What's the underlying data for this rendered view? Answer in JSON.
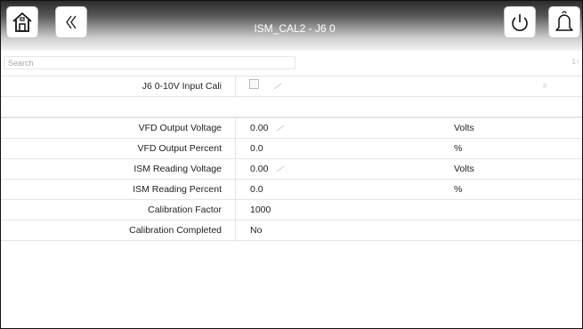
{
  "header": {
    "title": "ISM_CAL2 - J6 0"
  },
  "search": {
    "placeholder": "Search",
    "indicator": "1↑"
  },
  "rows": [
    {
      "label": "J6 0-10V Input Cali",
      "checkbox": false,
      "mark": "#"
    },
    {
      "label": "",
      "value": "",
      "unit": ""
    },
    {
      "label": "VFD Output Voltage",
      "value": "0.00",
      "unit": "Volts",
      "editable": true
    },
    {
      "label": "VFD Output Percent",
      "value": "0.0",
      "unit": "%"
    },
    {
      "label": "ISM Reading Voltage",
      "value": "0.00",
      "unit": "Volts",
      "editable": true
    },
    {
      "label": "ISM Reading Percent",
      "value": "0.0",
      "unit": "%"
    },
    {
      "label": "Calibration Factor",
      "value": "1000",
      "unit": ""
    },
    {
      "label": "Calibration Completed",
      "value": "No",
      "unit": ""
    }
  ],
  "icons": {
    "home": "home-icon",
    "back": "double-chevron-left-icon",
    "power": "power-icon",
    "alarm": "bell-icon",
    "edit": "pencil-icon"
  },
  "colors": {
    "header_dark": "#2b2b2b",
    "header_light": "#f4f4f4",
    "grid_line": "#e4e4e4"
  }
}
